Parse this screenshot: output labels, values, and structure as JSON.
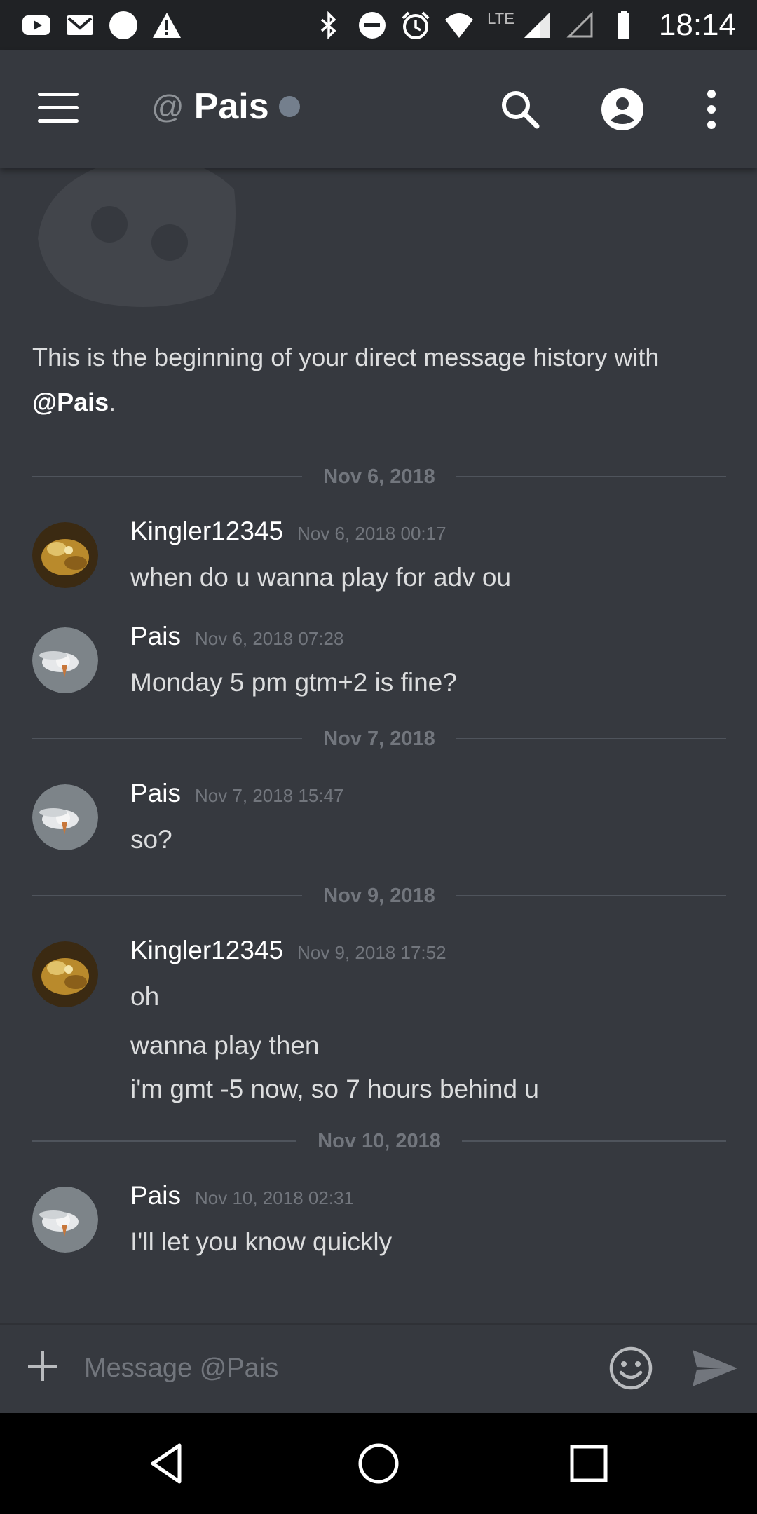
{
  "status_bar": {
    "time": "18:14",
    "network_label": "LTE",
    "left_icons": [
      "youtube-icon",
      "gmail-icon",
      "circle-notification-icon",
      "warning-icon"
    ],
    "right_icons": [
      "bluetooth-icon",
      "do-not-disturb-icon",
      "alarm-icon",
      "wifi-icon",
      "signal-icon",
      "signal-empty-icon",
      "battery-icon"
    ]
  },
  "header": {
    "at": "@",
    "title": "Pais",
    "presence_color": "#747f8d"
  },
  "intro": {
    "text_before": "This is the beginning of your direct message history with ",
    "mention": "@Pais",
    "text_after": "."
  },
  "dividers": [
    "Nov 6, 2018",
    "Nov 7, 2018",
    "Nov 9, 2018",
    "Nov 10, 2018"
  ],
  "messages": [
    {
      "author": "Kingler12345",
      "time": "Nov 6, 2018 00:17",
      "lines": [
        "when do u wanna play for adv ou"
      ]
    },
    {
      "author": "Pais",
      "time": "Nov 6, 2018 07:28",
      "lines": [
        "Monday 5 pm gtm+2 is fine?"
      ]
    },
    {
      "author": "Pais",
      "time": "Nov 7, 2018 15:47",
      "lines": [
        "so?"
      ]
    },
    {
      "author": "Kingler12345",
      "time": "Nov 9, 2018 17:52",
      "lines": [
        "oh",
        "wanna play then",
        "i'm gmt -5 now, so 7 hours behind u"
      ]
    },
    {
      "author": "Pais",
      "time": "Nov 10, 2018 02:31",
      "lines": [
        "I'll let you know quickly"
      ]
    }
  ],
  "composer": {
    "placeholder": "Message @Pais"
  },
  "colors": {
    "background": "#36393f",
    "status_bar": "#202225",
    "muted_text": "#72767d",
    "text": "#dcddde"
  }
}
